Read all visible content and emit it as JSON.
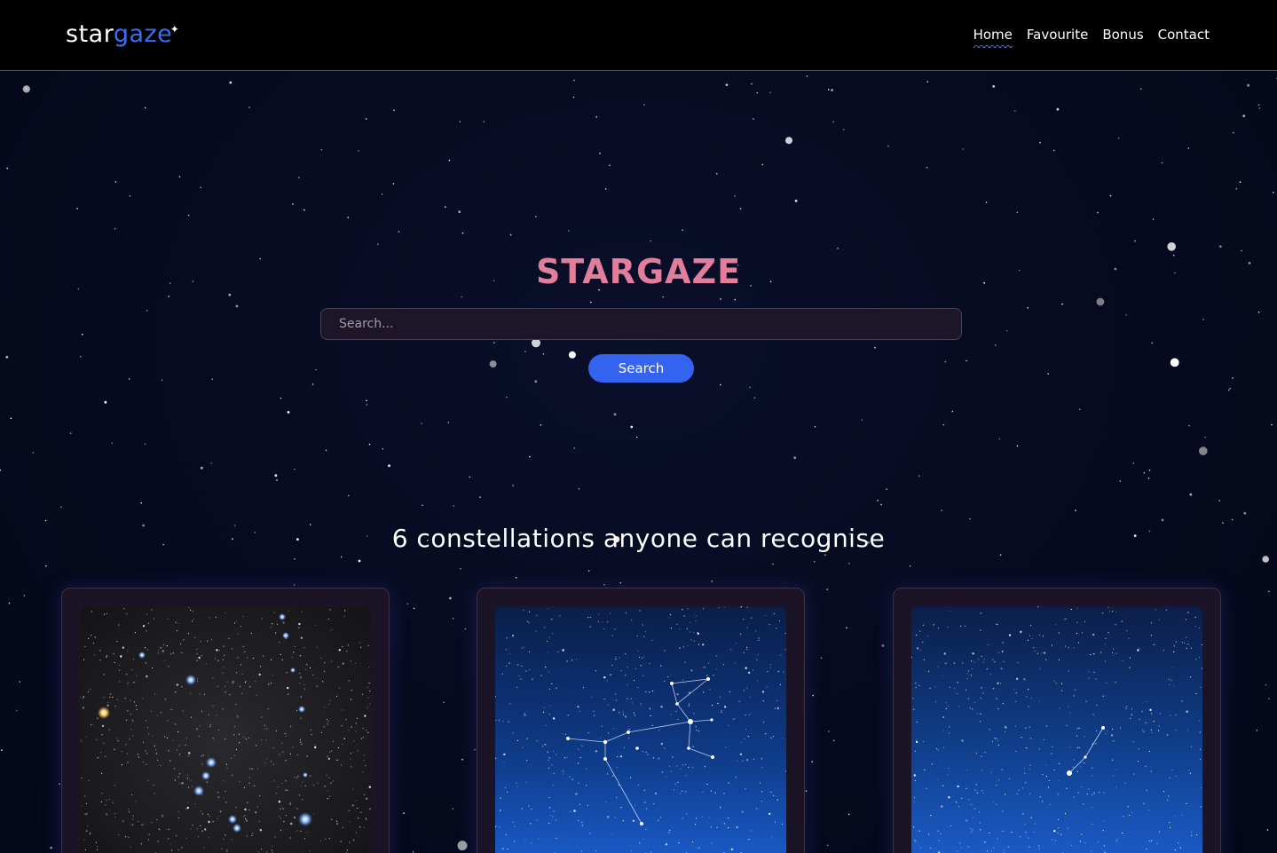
{
  "navbar": {
    "logo_part1": "star",
    "logo_part2": "gaze",
    "logo_star": "✦",
    "links": [
      {
        "label": "Home",
        "active": true
      },
      {
        "label": "Favourite",
        "active": false
      },
      {
        "label": "Bonus",
        "active": false
      },
      {
        "label": "Contact",
        "active": false
      }
    ]
  },
  "hero": {
    "title": "STARGAZE",
    "search_placeholder": "Search...",
    "search_button": "Search"
  },
  "section": {
    "heading": "6 constellations anyone can recognise"
  },
  "cards": [
    {
      "image": "orion-constellation-photo"
    },
    {
      "image": "big-dipper-constellation-photo"
    },
    {
      "image": "cassiopeia-constellation-photo"
    }
  ],
  "colors": {
    "background": "#070b1f",
    "navbar": "#000000",
    "accent": "#3463f0",
    "title": "#e07e9c"
  }
}
